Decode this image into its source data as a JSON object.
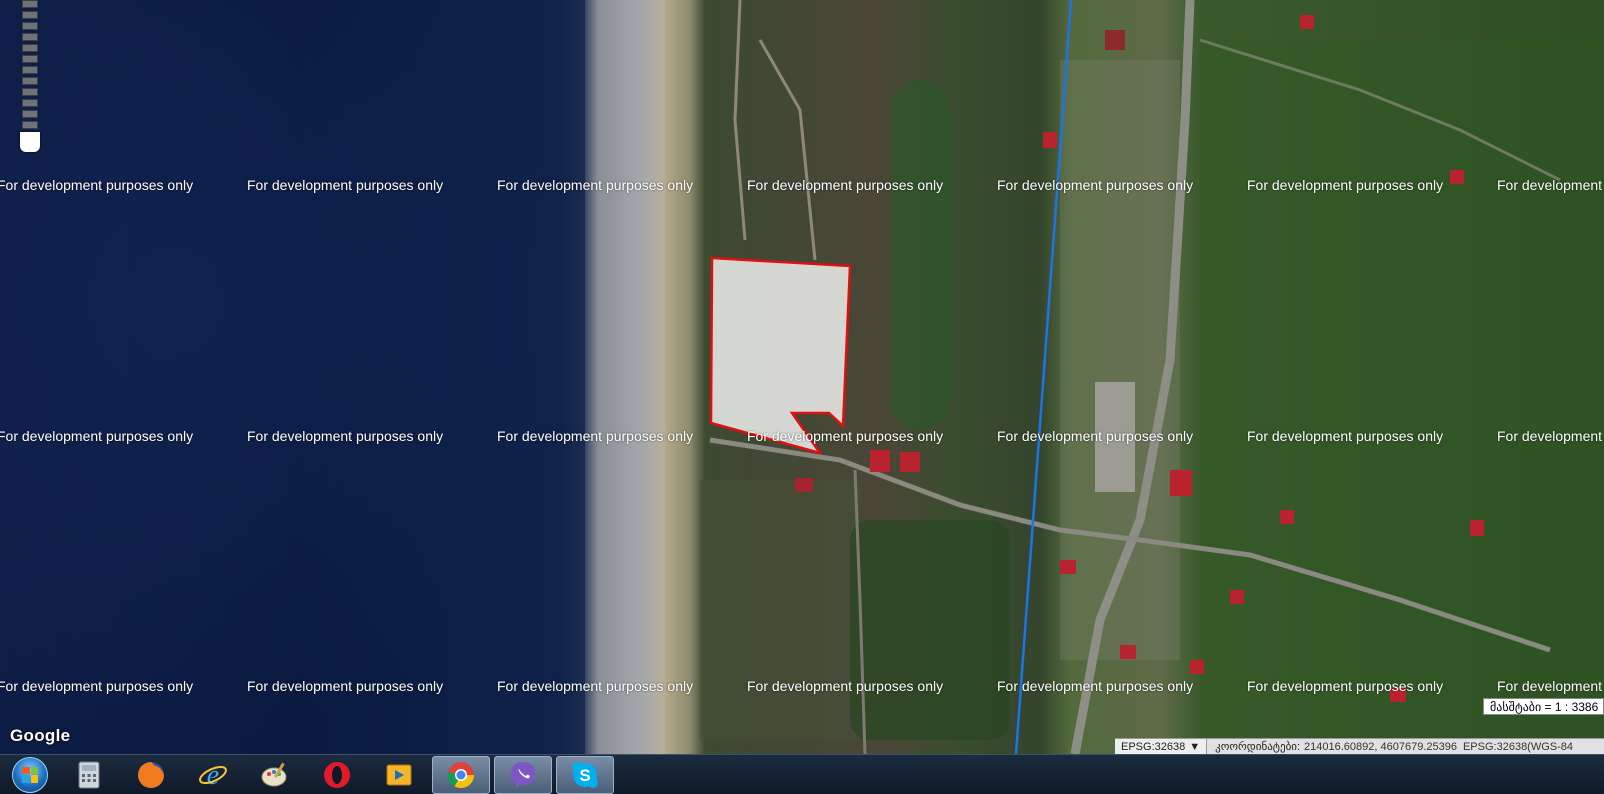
{
  "watermark": {
    "text": "For development purposes only",
    "rows": [
      177,
      428,
      678
    ],
    "cols": [
      -3,
      247,
      497,
      747,
      997,
      1247,
      1497
    ]
  },
  "map": {
    "attribution": "Google",
    "scale_text": "მასშტაბი = 1 : 3386",
    "projection_selected": "EPSG:32638",
    "coordinates_label": "კოორდინატები:",
    "coordinates_value": "214016.60892, 4607679.25396",
    "coordinates_suffix": "EPSG:32638(WGS-84",
    "boundary_line_color": "#1e73e8",
    "parcel_outline_color": "#e01010",
    "parcel_fill_color": "#ffffff"
  },
  "taskbar": {
    "items": [
      {
        "name": "start-button",
        "icon": "windows-start-icon"
      },
      {
        "name": "calculator",
        "icon": "calculator-icon"
      },
      {
        "name": "firefox",
        "icon": "firefox-icon"
      },
      {
        "name": "internet-explorer",
        "icon": "internet-explorer-icon"
      },
      {
        "name": "paint",
        "icon": "paint-icon"
      },
      {
        "name": "opera",
        "icon": "opera-icon"
      },
      {
        "name": "media-player",
        "icon": "media-player-icon"
      },
      {
        "name": "chrome",
        "icon": "chrome-icon",
        "active": true
      },
      {
        "name": "viber",
        "icon": "viber-icon"
      },
      {
        "name": "skype",
        "icon": "skype-icon"
      }
    ]
  }
}
